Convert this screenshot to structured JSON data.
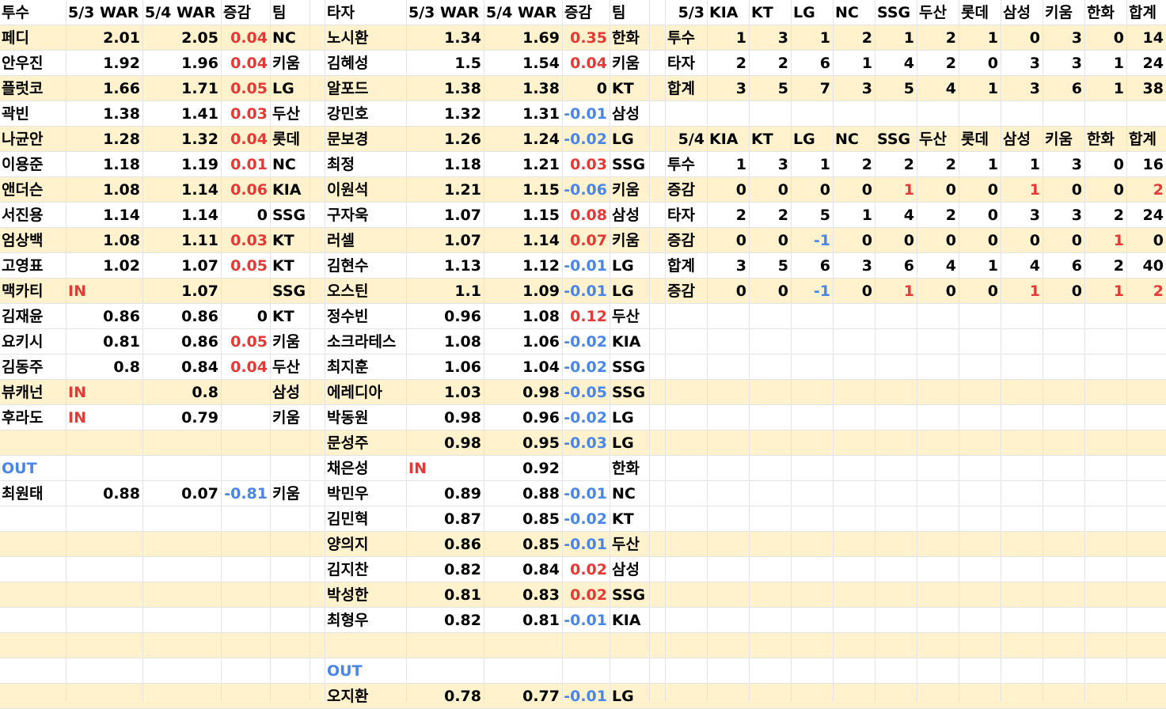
{
  "pitcher_table": {
    "headers": [
      "투수",
      "5/3 WAR",
      "5/4 WAR",
      "증감",
      "팀"
    ],
    "rows": [
      [
        "페디",
        "2.01",
        "2.05",
        "0.04",
        "NC"
      ],
      [
        "안우진",
        "1.92",
        "1.96",
        "0.04",
        "키움"
      ],
      [
        "플럿코",
        "1.66",
        "1.71",
        "0.05",
        "LG"
      ],
      [
        "곽빈",
        "1.38",
        "1.41",
        "0.03",
        "두산"
      ],
      [
        "나균안",
        "1.28",
        "1.32",
        "0.04",
        "롯데"
      ],
      [
        "이용준",
        "1.18",
        "1.19",
        "0.01",
        "NC"
      ],
      [
        "앤더슨",
        "1.08",
        "1.14",
        "0.06",
        "KIA"
      ],
      [
        "서진용",
        "1.14",
        "1.14",
        "0",
        "SSG"
      ],
      [
        "엄상백",
        "1.08",
        "1.11",
        "0.03",
        "KT"
      ],
      [
        "고영표",
        "1.02",
        "1.07",
        "0.05",
        "KT"
      ],
      [
        "맥카티",
        "IN",
        "1.07",
        "",
        "SSG"
      ],
      [
        "김재윤",
        "0.86",
        "0.86",
        "0",
        "KT"
      ],
      [
        "요키시",
        "0.81",
        "0.86",
        "0.05",
        "키움"
      ],
      [
        "김동주",
        "0.8",
        "0.84",
        "0.04",
        "두산"
      ],
      [
        "뷰캐넌",
        "IN",
        "0.8",
        "",
        "삼성"
      ],
      [
        "후라도",
        "IN",
        "0.79",
        "",
        "키움"
      ],
      [
        "",
        "",
        "",
        "",
        ""
      ],
      [
        "OUT",
        "",
        "",
        "",
        ""
      ],
      [
        "최원태",
        "0.88",
        "0.07",
        "-0.81",
        "키움"
      ]
    ]
  },
  "batter_table": {
    "headers": [
      "타자",
      "5/3 WAR",
      "5/4 WAR",
      "증감",
      "팀"
    ],
    "rows": [
      [
        "노시환",
        "1.34",
        "1.69",
        "0.35",
        "한화"
      ],
      [
        "김혜성",
        "1.5",
        "1.54",
        "0.04",
        "키움"
      ],
      [
        "알포드",
        "1.38",
        "1.38",
        "0",
        "KT"
      ],
      [
        "강민호",
        "1.32",
        "1.31",
        "-0.01",
        "삼성"
      ],
      [
        "문보경",
        "1.26",
        "1.24",
        "-0.02",
        "LG"
      ],
      [
        "최정",
        "1.18",
        "1.21",
        "0.03",
        "SSG"
      ],
      [
        "이원석",
        "1.21",
        "1.15",
        "-0.06",
        "키움"
      ],
      [
        "구자욱",
        "1.07",
        "1.15",
        "0.08",
        "삼성"
      ],
      [
        "러셀",
        "1.07",
        "1.14",
        "0.07",
        "키움"
      ],
      [
        "김현수",
        "1.13",
        "1.12",
        "-0.01",
        "LG"
      ],
      [
        "오스틴",
        "1.1",
        "1.09",
        "-0.01",
        "LG"
      ],
      [
        "정수빈",
        "0.96",
        "1.08",
        "0.12",
        "두산"
      ],
      [
        "소크라테스",
        "1.08",
        "1.06",
        "-0.02",
        "KIA"
      ],
      [
        "최지훈",
        "1.06",
        "1.04",
        "-0.02",
        "SSG"
      ],
      [
        "에레디아",
        "1.03",
        "0.98",
        "-0.05",
        "SSG"
      ],
      [
        "박동원",
        "0.98",
        "0.96",
        "-0.02",
        "LG"
      ],
      [
        "문성주",
        "0.98",
        "0.95",
        "-0.03",
        "LG"
      ],
      [
        "채은성",
        "IN",
        "0.92",
        "",
        "한화"
      ],
      [
        "박민우",
        "0.89",
        "0.88",
        "-0.01",
        "NC"
      ],
      [
        "김민혁",
        "0.87",
        "0.85",
        "-0.02",
        "KT"
      ],
      [
        "양의지",
        "0.86",
        "0.85",
        "-0.01",
        "두산"
      ],
      [
        "김지찬",
        "0.82",
        "0.84",
        "0.02",
        "삼성"
      ],
      [
        "박성한",
        "0.81",
        "0.83",
        "0.02",
        "SSG"
      ],
      [
        "최형우",
        "0.82",
        "0.81",
        "-0.01",
        "KIA"
      ],
      [
        "",
        "",
        "",
        "",
        ""
      ],
      [
        "OUT",
        "",
        "",
        "",
        ""
      ],
      [
        "오지환",
        "0.78",
        "0.77",
        "-0.01",
        "LG"
      ]
    ]
  },
  "team_summary_53": {
    "headers": [
      "5/3",
      "KIA",
      "KT",
      "LG",
      "NC",
      "SSG",
      "두산",
      "롯데",
      "삼성",
      "키움",
      "한화",
      "합계"
    ],
    "rows": [
      [
        "투수",
        "1",
        "3",
        "1",
        "2",
        "1",
        "2",
        "1",
        "0",
        "3",
        "0",
        "14"
      ],
      [
        "타자",
        "2",
        "2",
        "6",
        "1",
        "4",
        "2",
        "0",
        "3",
        "3",
        "1",
        "24"
      ],
      [
        "합계",
        "3",
        "5",
        "7",
        "3",
        "5",
        "4",
        "1",
        "3",
        "6",
        "1",
        "38"
      ]
    ]
  },
  "team_summary_54": {
    "headers": [
      "5/4",
      "KIA",
      "KT",
      "LG",
      "NC",
      "SSG",
      "두산",
      "롯데",
      "삼성",
      "키움",
      "한화",
      "합계"
    ],
    "rows": [
      [
        "투수",
        "1",
        "3",
        "1",
        "2",
        "2",
        "2",
        "1",
        "1",
        "3",
        "0",
        "16"
      ],
      [
        "증감",
        "0",
        "0",
        "0",
        "0",
        "1",
        "0",
        "0",
        "1",
        "0",
        "0",
        "2"
      ],
      [
        "타자",
        "2",
        "2",
        "5",
        "1",
        "4",
        "2",
        "0",
        "3",
        "3",
        "2",
        "24"
      ],
      [
        "증감",
        "0",
        "0",
        "-1",
        "0",
        "0",
        "0",
        "0",
        "0",
        "0",
        "1",
        "0"
      ],
      [
        "합계",
        "3",
        "5",
        "6",
        "3",
        "6",
        "4",
        "1",
        "4",
        "6",
        "2",
        "40"
      ],
      [
        "증감",
        "0",
        "0",
        "-1",
        "0",
        "1",
        "0",
        "0",
        "1",
        "0",
        "1",
        "2"
      ]
    ]
  },
  "colors": {
    "highlight_row": "#fff2cc",
    "gridline": "#e2e3e3",
    "positive": "#e53935",
    "negative": "#4a86e8"
  }
}
